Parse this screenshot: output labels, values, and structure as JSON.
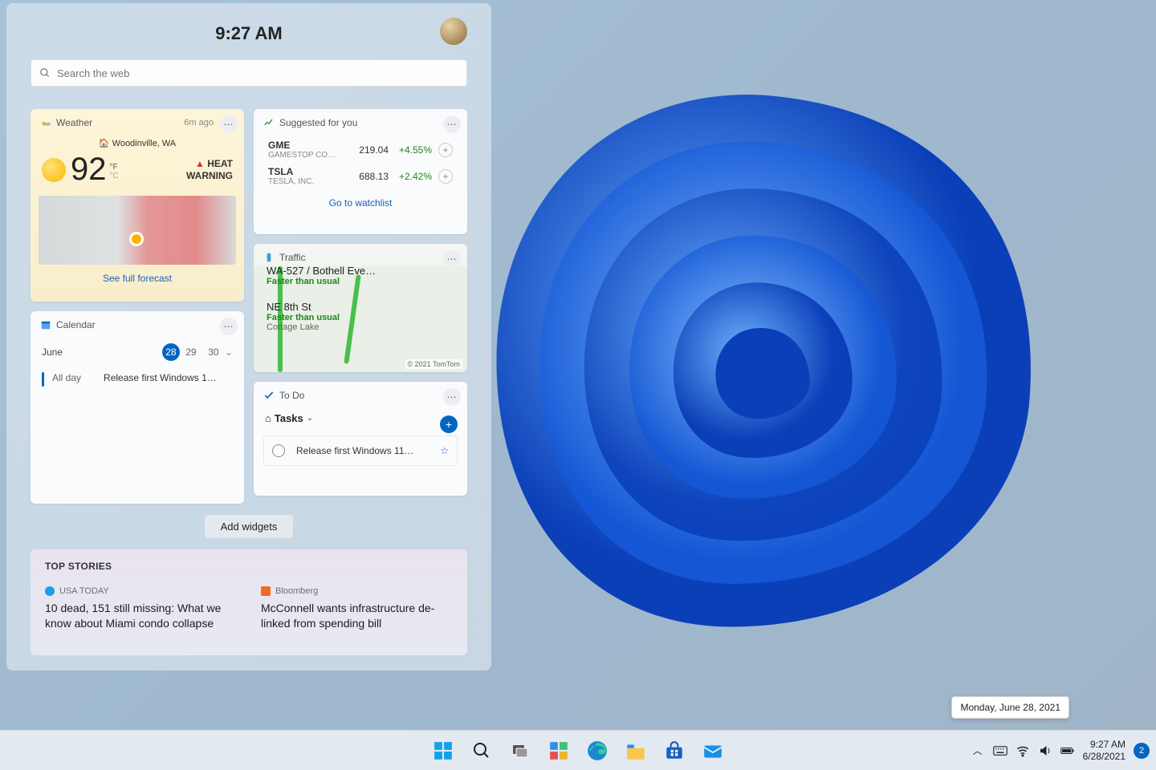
{
  "header": {
    "time": "9:27 AM"
  },
  "search": {
    "placeholder": "Search the web"
  },
  "weather": {
    "title": "Weather",
    "age": "6m ago",
    "location": "Woodinville, WA",
    "temp": "92",
    "unit_top": "°F",
    "unit_bottom": "°C",
    "warn_icon": "▲",
    "warn1": "HEAT",
    "warn2": "WARNING",
    "link": "See full forecast"
  },
  "calendar": {
    "title": "Calendar",
    "month": "June",
    "days": [
      "28",
      "29",
      "30"
    ],
    "selected": "28",
    "event_time": "All day",
    "event_title": "Release first Windows 1…"
  },
  "stocks": {
    "title": "Suggested for you",
    "rows": [
      {
        "sym": "GME",
        "name": "GAMESTOP CO…",
        "price": "219.04",
        "chg": "+4.55%"
      },
      {
        "sym": "TSLA",
        "name": "TESLA, INC.",
        "price": "688.13",
        "chg": "+2.42%"
      }
    ],
    "link": "Go to watchlist"
  },
  "traffic": {
    "title": "Traffic",
    "line1": "WA-527 / Bothell Eve…",
    "sub1": "Faster than usual",
    "line2": "NE 8th St",
    "sub2": "Faster than usual",
    "place": "Cottage Lake",
    "copy": "© 2021 TomTom"
  },
  "todo": {
    "title": "To Do",
    "list": "Tasks",
    "item": "Release first Windows 11…"
  },
  "add_widgets": "Add widgets",
  "news": {
    "heading": "TOP STORIES",
    "items": [
      {
        "src": "USA TODAY",
        "color": "#1aa0e8",
        "title": "10 dead, 151 still missing: What we know about Miami condo collapse"
      },
      {
        "src": "Bloomberg",
        "color": "#f06b1f",
        "title": "McConnell wants infrastructure de-linked from spending bill"
      }
    ]
  },
  "tooltip": "Monday, June 28, 2021",
  "taskbar": {
    "time": "9:27 AM",
    "date": "6/28/2021",
    "notif": "2"
  }
}
